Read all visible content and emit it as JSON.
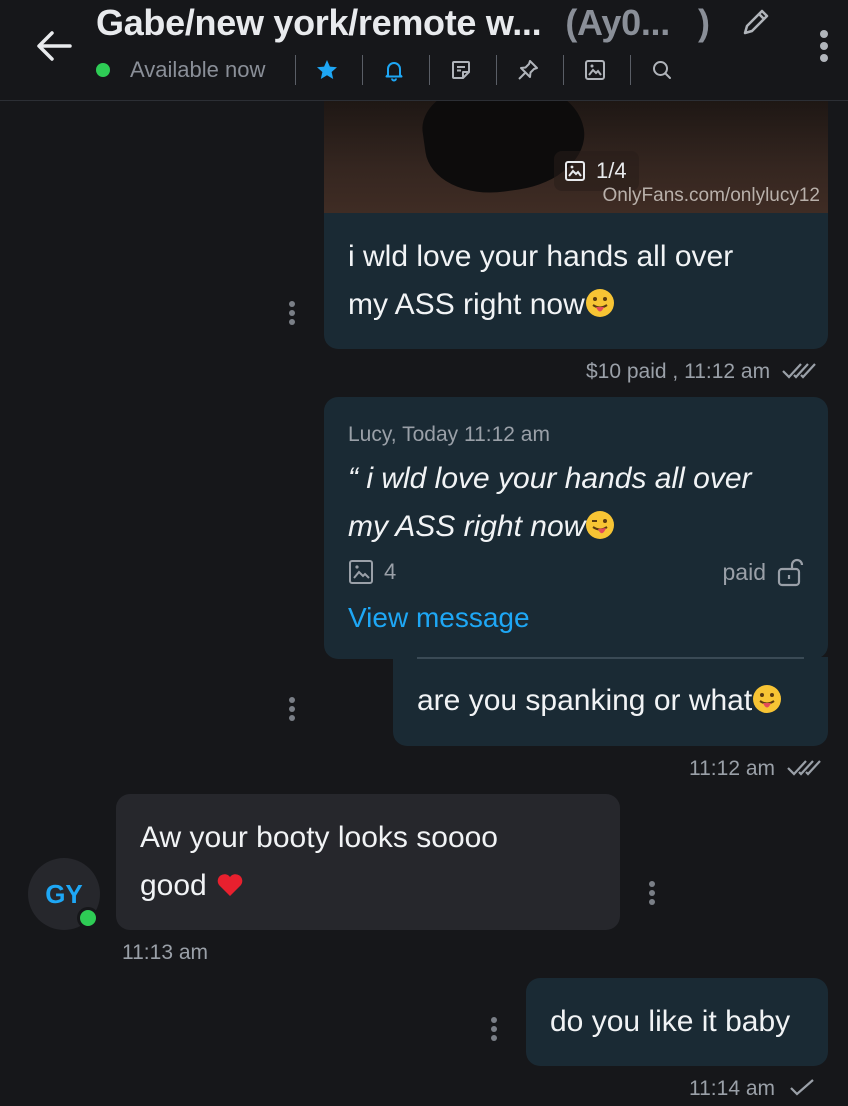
{
  "header": {
    "title": "Gabe/new york/remote w...",
    "handle": "(Ay0...",
    "handle_close": ")",
    "status": "Available now",
    "colors": {
      "online": "#2ecc55",
      "accent": "#1ea7f5"
    },
    "icons": [
      "back-arrow-icon",
      "edit-pencil-icon",
      "more-vertical-icon",
      "star-icon",
      "bell-icon",
      "note-icon",
      "pin-icon",
      "image-gallery-icon",
      "search-icon"
    ]
  },
  "messages": {
    "photo": {
      "counter": "1/4",
      "watermark": "OnlyFans.com/onlylucy12"
    },
    "m1": {
      "line1": "i wld love your hands all over",
      "line2": "my ASS right now",
      "meta": "$10 paid , 11:12 am"
    },
    "m2": {
      "quote_author": "Lucy, Today 11:12 am",
      "quote_line1": "“ i wld love your hands all over",
      "quote_line2": "my ASS right now",
      "media_count": "4",
      "paid": "paid",
      "view_link": "View message",
      "reply": "are you spanking or what",
      "meta": "11:12 am"
    },
    "m3": {
      "avatar": "GY",
      "line1": "Aw your booty looks soooo",
      "line2": "good",
      "meta": "11:13 am"
    },
    "m4": {
      "text": "do you like it baby",
      "meta": "11:14 am"
    }
  }
}
